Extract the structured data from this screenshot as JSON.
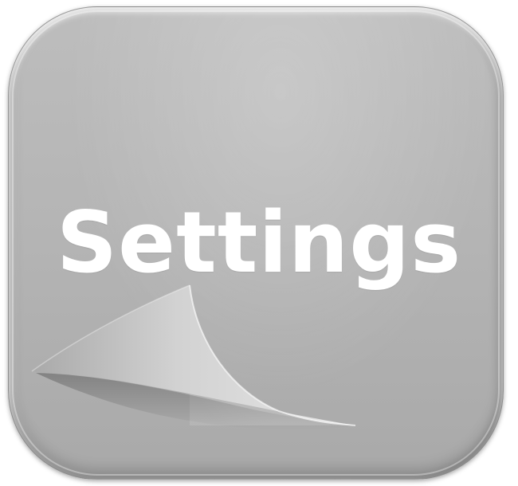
{
  "icon": {
    "label": "Settings",
    "glyph": "page-curl-icon"
  },
  "colors": {
    "tile": "#b6b6b6",
    "text": "#ffffff"
  }
}
